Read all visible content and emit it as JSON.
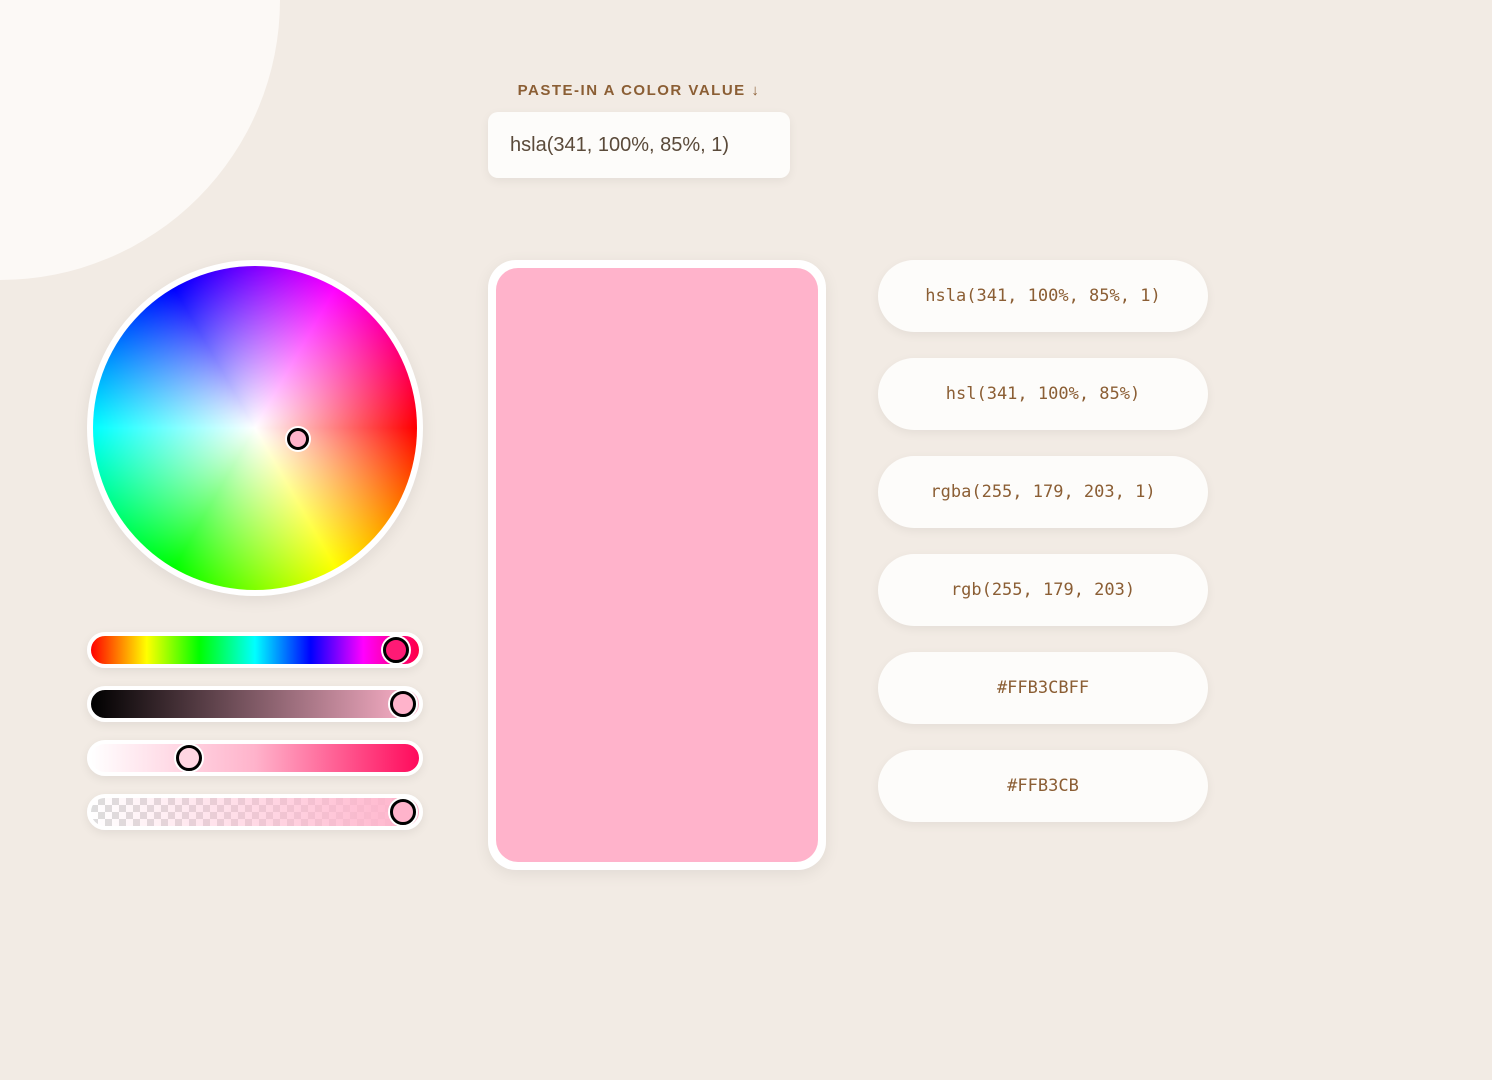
{
  "input": {
    "label": "PASTE-IN A COLOR VALUE ↓",
    "value": "hsla(341, 100%, 85%, 1)"
  },
  "swatch_color": "#FFB3CB",
  "formats": {
    "hsla": "hsla(341, 100%, 85%, 1)",
    "hsl": "hsl(341, 100%, 85%)",
    "rgba": "rgba(255, 179, 203, 1)",
    "rgb": "rgb(255, 179, 203)",
    "hex8": "#FFB3CBFF",
    "hex6": "#FFB3CB"
  }
}
